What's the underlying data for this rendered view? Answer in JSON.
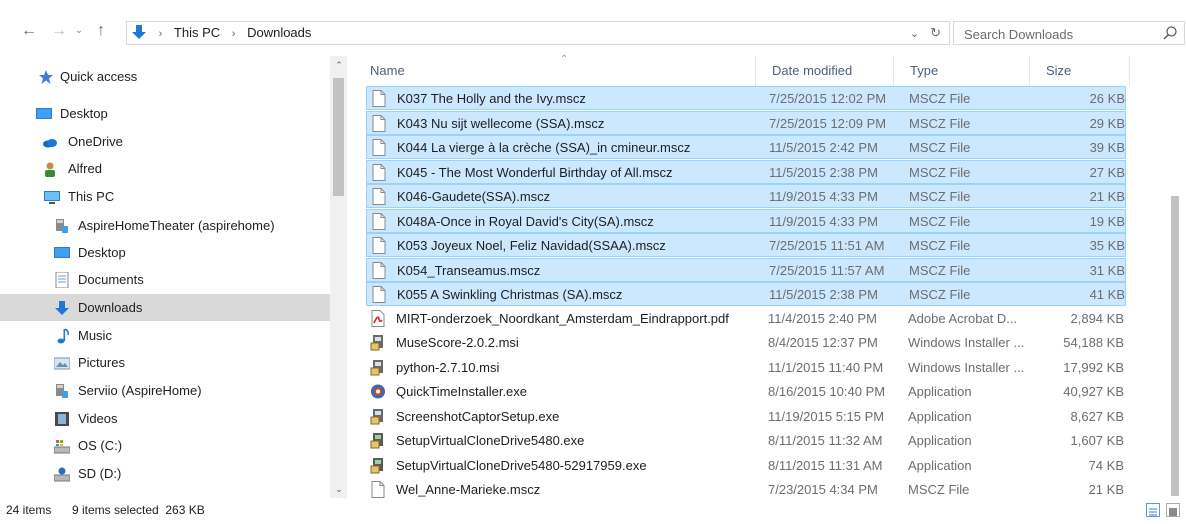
{
  "address": {
    "breadcrumb": [
      "This PC",
      "Downloads"
    ],
    "dropdown_glyph": "⌄",
    "refresh_glyph": "↻"
  },
  "search": {
    "placeholder": "Search Downloads"
  },
  "nav": {
    "items": [
      {
        "label": "Quick access",
        "icon": "star-icon"
      },
      {
        "label": "Desktop",
        "icon": "desktop-icon"
      },
      {
        "label": "OneDrive",
        "icon": "cloud-icon"
      },
      {
        "label": "Alfred",
        "icon": "user-icon"
      },
      {
        "label": "This PC",
        "icon": "computer-icon"
      },
      {
        "label": "AspireHomeTheater (aspirehome)",
        "icon": "media-server-icon"
      },
      {
        "label": "Desktop",
        "icon": "desktop-icon"
      },
      {
        "label": "Documents",
        "icon": "documents-icon"
      },
      {
        "label": "Downloads",
        "icon": "download-arrow-icon",
        "selected": true
      },
      {
        "label": "Music",
        "icon": "music-note-icon"
      },
      {
        "label": "Pictures",
        "icon": "pictures-icon"
      },
      {
        "label": "Serviio (AspireHome)",
        "icon": "media-server-icon"
      },
      {
        "label": "Videos",
        "icon": "film-icon"
      },
      {
        "label": "OS (C:)",
        "icon": "drive-icon"
      },
      {
        "label": "SD (D:)",
        "icon": "drive-icon"
      }
    ]
  },
  "columns": {
    "name": "Name",
    "date": "Date modified",
    "type": "Type",
    "size": "Size"
  },
  "files": [
    {
      "name": "K037 The Holly and the Ivy.mscz",
      "date": "7/25/2015 12:02 PM",
      "type": "MSCZ File",
      "size": "26 KB",
      "selected": true,
      "icon": "document-icon"
    },
    {
      "name": "K043 Nu sijt wellecome  (SSA).mscz",
      "date": "7/25/2015 12:09 PM",
      "type": "MSCZ File",
      "size": "29 KB",
      "selected": true,
      "icon": "document-icon"
    },
    {
      "name": "K044 La vierge à la crèche (SSA)_in cmineur.mscz",
      "date": "11/5/2015 2:42 PM",
      "type": "MSCZ File",
      "size": "39 KB",
      "selected": true,
      "icon": "document-icon"
    },
    {
      "name": "K045 - The Most Wonderful Birthday of All.mscz",
      "date": "11/5/2015 2:38 PM",
      "type": "MSCZ File",
      "size": "27 KB",
      "selected": true,
      "icon": "document-icon"
    },
    {
      "name": "K046-Gaudete(SSA).mscz",
      "date": "11/9/2015 4:33 PM",
      "type": "MSCZ File",
      "size": "21 KB",
      "selected": true,
      "icon": "document-icon"
    },
    {
      "name": "K048A-Once in Royal David's City(SA).mscz",
      "date": "11/9/2015 4:33 PM",
      "type": "MSCZ File",
      "size": "19 KB",
      "selected": true,
      "icon": "document-icon"
    },
    {
      "name": "K053 Joyeux Noel, Feliz Navidad(SSAA).mscz",
      "date": "7/25/2015 11:51 AM",
      "type": "MSCZ File",
      "size": "35 KB",
      "selected": true,
      "icon": "document-icon"
    },
    {
      "name": "K054_Transeamus.mscz",
      "date": "7/25/2015 11:57 AM",
      "type": "MSCZ File",
      "size": "31 KB",
      "selected": true,
      "icon": "document-icon"
    },
    {
      "name": "K055 A Swinkling Christmas (SA).mscz",
      "date": "11/5/2015 2:38 PM",
      "type": "MSCZ File",
      "size": "41 KB",
      "selected": true,
      "icon": "document-icon"
    },
    {
      "name": "MIRT-onderzoek_Noordkant_Amsterdam_Eindrapport.pdf",
      "date": "11/4/2015 2:40 PM",
      "type": "Adobe Acrobat D...",
      "size": "2,894 KB",
      "selected": false,
      "icon": "pdf-icon"
    },
    {
      "name": "MuseScore-2.0.2.msi",
      "date": "8/4/2015 12:37 PM",
      "type": "Windows Installer ...",
      "size": "54,188 KB",
      "selected": false,
      "icon": "installer-icon"
    },
    {
      "name": "python-2.7.10.msi",
      "date": "11/1/2015 11:40 PM",
      "type": "Windows Installer ...",
      "size": "17,992 KB",
      "selected": false,
      "icon": "installer-icon"
    },
    {
      "name": "QuickTimeInstaller.exe",
      "date": "8/16/2015 10:40 PM",
      "type": "Application",
      "size": "40,927 KB",
      "selected": false,
      "icon": "quicktime-icon"
    },
    {
      "name": "ScreenshotCaptorSetup.exe",
      "date": "11/19/2015 5:15 PM",
      "type": "Application",
      "size": "8,627 KB",
      "selected": false,
      "icon": "installer-icon"
    },
    {
      "name": "SetupVirtualCloneDrive5480.exe",
      "date": "8/11/2015 11:32 AM",
      "type": "Application",
      "size": "1,607 KB",
      "selected": false,
      "icon": "setup-icon"
    },
    {
      "name": "SetupVirtualCloneDrive5480-52917959.exe",
      "date": "8/11/2015 11:31 AM",
      "type": "Application",
      "size": "74 KB",
      "selected": false,
      "icon": "setup-icon"
    },
    {
      "name": "Wel_Anne-Marieke.mscz",
      "date": "7/23/2015 4:34 PM",
      "type": "MSCZ File",
      "size": "21 KB",
      "selected": false,
      "icon": "document-icon"
    }
  ],
  "status": {
    "item_count": "24 items",
    "selection": "9 items selected  263 KB"
  },
  "colors": {
    "selection_bg": "#cce8ff",
    "selection_border": "#99d1ff",
    "nav_selected": "#d9d9d9",
    "accent": "#1e78d7"
  }
}
